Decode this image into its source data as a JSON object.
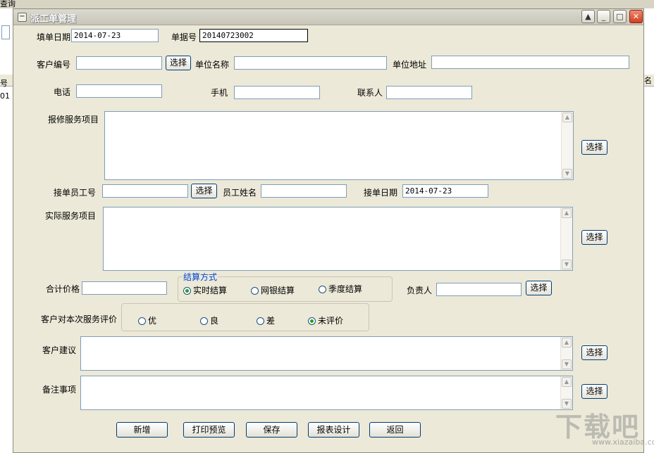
{
  "background": {
    "title_fragment": "查询",
    "col_header_left": "号",
    "row_value_left": "01",
    "col_header_right": "名"
  },
  "window": {
    "title": "派工单管理",
    "sys_icon": "−",
    "controls": {
      "restore": "▲",
      "minimize": "_",
      "maximize": "□",
      "close": "✕"
    }
  },
  "form": {
    "fill_date": {
      "label": "填单日期",
      "value": "2014-07-23"
    },
    "doc_no": {
      "label": "单据号",
      "value": "20140723002"
    },
    "customer_no": {
      "label": "客户编号",
      "value": "",
      "button": "选择"
    },
    "company_name": {
      "label": "单位名称",
      "value": ""
    },
    "company_address": {
      "label": "单位地址",
      "value": ""
    },
    "phone": {
      "label": "电话",
      "value": ""
    },
    "mobile": {
      "label": "手机",
      "value": ""
    },
    "contact": {
      "label": "联系人",
      "value": ""
    },
    "repair_items": {
      "label": "报修服务项目",
      "value": "",
      "button": "选择"
    },
    "receiver_id": {
      "label": "接单员工号",
      "value": "",
      "button": "选择"
    },
    "employee_name": {
      "label": "员工姓名",
      "value": ""
    },
    "receive_date": {
      "label": "接单日期",
      "value": "2014-07-23"
    },
    "actual_items": {
      "label": "实际服务项目",
      "value": "",
      "button": "选择"
    },
    "total_price": {
      "label": "合计价格",
      "value": ""
    },
    "settlement": {
      "label": "结算方式",
      "options": [
        {
          "label": "实时结算",
          "selected": true
        },
        {
          "label": "网银结算",
          "selected": false
        },
        {
          "label": "季度结算",
          "selected": false
        }
      ]
    },
    "manager": {
      "label": "负责人",
      "value": "",
      "button": "选择"
    },
    "evaluation": {
      "label": "客户对本次服务评价",
      "options": [
        {
          "label": "优",
          "selected": false
        },
        {
          "label": "良",
          "selected": false
        },
        {
          "label": "差",
          "selected": false
        },
        {
          "label": "未评价",
          "selected": true
        }
      ]
    },
    "suggestion": {
      "label": "客户建议",
      "value": "",
      "button": "选择"
    },
    "remarks": {
      "label": "备注事项",
      "value": "",
      "button": "选择"
    }
  },
  "actions": {
    "new": "新增",
    "print_preview": "打印预览",
    "save": "保存",
    "report_design": "报表设计",
    "back": "返回"
  },
  "scroll_arrows": {
    "up": "▲",
    "down": "▼"
  },
  "watermark": {
    "text": "下载吧",
    "url": "www.xiazaiba.com"
  }
}
